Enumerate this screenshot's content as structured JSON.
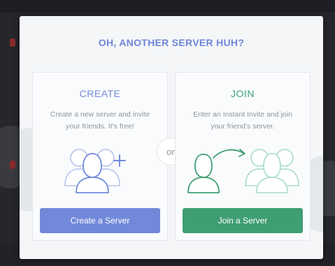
{
  "modal": {
    "title": "OH, ANOTHER SERVER HUH?"
  },
  "create": {
    "title": "CREATE",
    "description": "Create a new server and invite your friends. It's free!",
    "button_label": "Create a Server",
    "icon": "users-plus-icon",
    "accent_color": "#7289da"
  },
  "join": {
    "title": "JOIN",
    "description": "Enter an Instant Invite and join your friend's server.",
    "button_label": "Join a Server",
    "icon": "user-join-group-icon",
    "accent_color": "#3f9e72"
  },
  "divider": {
    "label": "or"
  }
}
